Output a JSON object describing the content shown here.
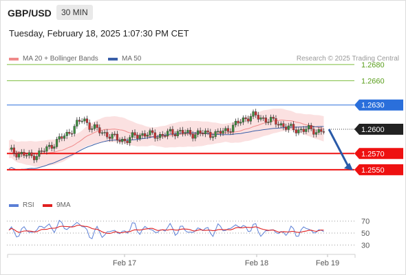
{
  "header": {
    "symbol": "GBP/USD",
    "timeframe": "30 MIN",
    "datetime": "Tuesday, February 18, 2025 1:07:30 PM CET"
  },
  "legend": {
    "ma20": {
      "label": "MA 20 + Bollinger Bands",
      "color": "#f08a8a"
    },
    "ma50": {
      "label": "MA 50",
      "color": "#3a5fa8"
    },
    "credit": "Research © 2025 Trading Central"
  },
  "rsi_legend": {
    "rsi": {
      "label": "RSI",
      "color": "#5b7fd6"
    },
    "ma9": {
      "label": "9MA",
      "color": "#e02020"
    }
  },
  "chart_data": {
    "type": "candlestick",
    "y_axis": {
      "min": 1.2515,
      "max": 1.2685
    },
    "current_price": {
      "value": 1.26,
      "label": "1.2600"
    },
    "levels": [
      {
        "value": 1.268,
        "label": "1.2680",
        "kind": "resistance_target",
        "color": "#7cbd3c"
      },
      {
        "value": 1.266,
        "label": "1.2660",
        "kind": "resistance_target",
        "color": "#7cbd3c"
      },
      {
        "value": 1.263,
        "label": "1.2630",
        "kind": "pivot",
        "color": "#2a6fdb"
      },
      {
        "value": 1.257,
        "label": "1.2570",
        "kind": "support_target",
        "color": "#ee1111"
      },
      {
        "value": 1.255,
        "label": "1.2550",
        "kind": "support_target",
        "color": "#ee1111"
      }
    ],
    "x_labels": [
      "Feb 17",
      "Feb 18",
      "Feb 19"
    ],
    "rsi": {
      "levels": [
        70,
        50,
        30
      ],
      "level_labels": [
        "70",
        "50",
        "30"
      ]
    },
    "forecast": {
      "direction": "down",
      "from_price": 1.26,
      "to_price": 1.255
    }
  }
}
